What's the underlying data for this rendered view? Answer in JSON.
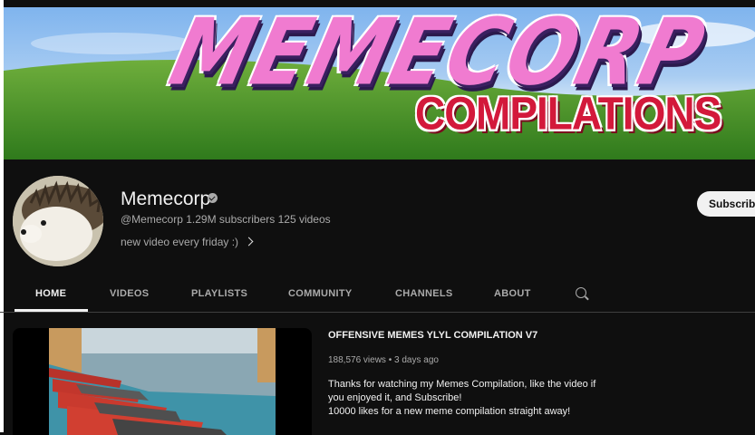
{
  "banner": {
    "title_line1": "MEMECORP",
    "title_line2": "COMPILATIONS"
  },
  "channel": {
    "name": "Memecorp",
    "handle": "@Memecorp",
    "subscribers": "1.29M subscribers",
    "videos": "125 videos",
    "description": "new video every friday :)",
    "subscribe_label": "Subscribe"
  },
  "tabs": [
    {
      "label": "HOME",
      "active": true
    },
    {
      "label": "VIDEOS"
    },
    {
      "label": "PLAYLISTS"
    },
    {
      "label": "COMMUNITY"
    },
    {
      "label": "CHANNELS"
    },
    {
      "label": "ABOUT"
    }
  ],
  "featured": {
    "title": "OFFENSIVE MEMES YLYL COMPILATION V7",
    "views": "188,576 views",
    "separator": "•",
    "age": "3 days ago",
    "description_lines": [
      "Thanks for watching my Memes Compilation, like the video if",
      "you enjoyed it, and Subscribe!",
      "10000 likes for a new meme compilation straight away!"
    ]
  },
  "colors": {
    "background": "#0f0f0f",
    "text_primary": "#f1f1f1",
    "text_secondary": "#aaaaaa",
    "banner_pink": "#f07bd0",
    "banner_red": "#d3193b"
  },
  "icons": [
    "verified-icon",
    "chevron-right-icon",
    "search-icon"
  ]
}
